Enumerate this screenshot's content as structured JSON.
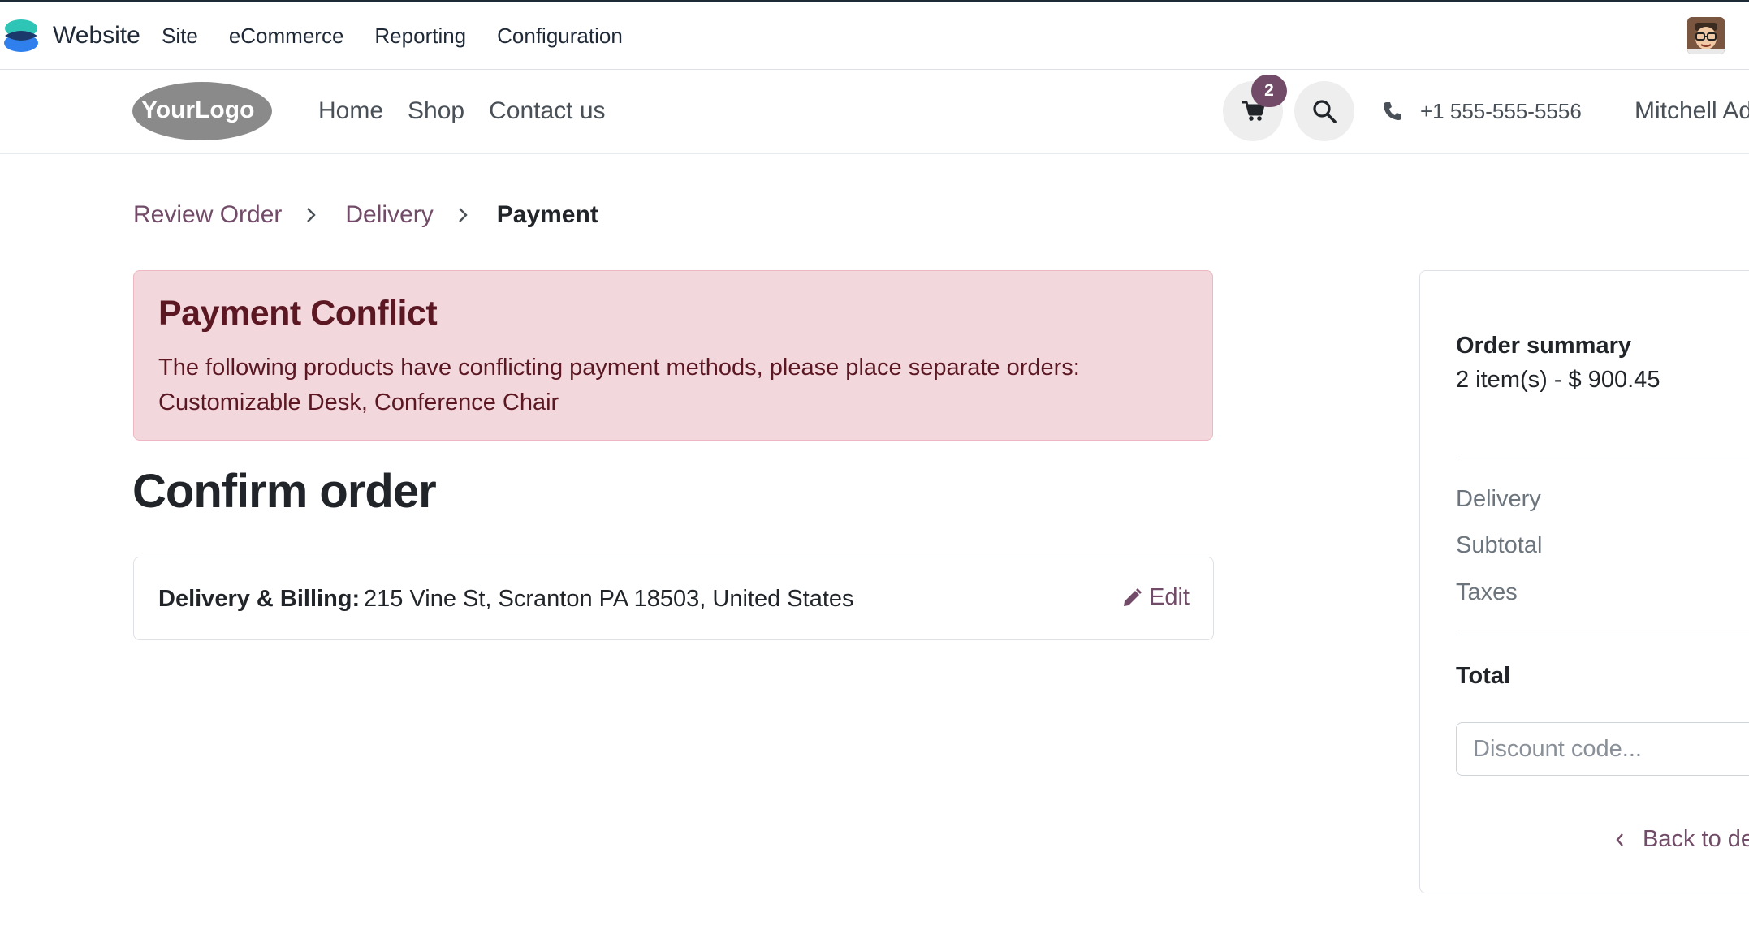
{
  "backend": {
    "app_name": "Website",
    "menu": [
      "Site",
      "eCommerce",
      "Reporting",
      "Configuration"
    ]
  },
  "header": {
    "logo_text": "YourLogo",
    "nav": [
      "Home",
      "Shop",
      "Contact us"
    ],
    "cart_count": "2",
    "phone": "+1 555-555-5556",
    "user_name": "Mitchell Ad"
  },
  "breadcrumb": {
    "step1": "Review Order",
    "step2": "Delivery",
    "step3": "Payment"
  },
  "alert": {
    "title": "Payment Conflict",
    "message": "The following products have conflicting payment methods, please place separate orders: Customizable Desk, Conference Chair"
  },
  "page_title": "Confirm order",
  "address": {
    "label": "Delivery & Billing:",
    "value": "215 Vine St, Scranton PA 18503, United States",
    "edit_label": "Edit"
  },
  "summary": {
    "title": "Order summary",
    "items": "2 item(s) -  $ 900.45",
    "delivery_label": "Delivery",
    "subtotal_label": "Subtotal",
    "taxes_label": "Taxes",
    "total_label": "Total",
    "discount_placeholder": "Discount code...",
    "back_label": "Back to de"
  },
  "colors": {
    "brand": "#714B67",
    "alert_bg": "#f2d7dd",
    "alert_text": "#5c1822"
  }
}
